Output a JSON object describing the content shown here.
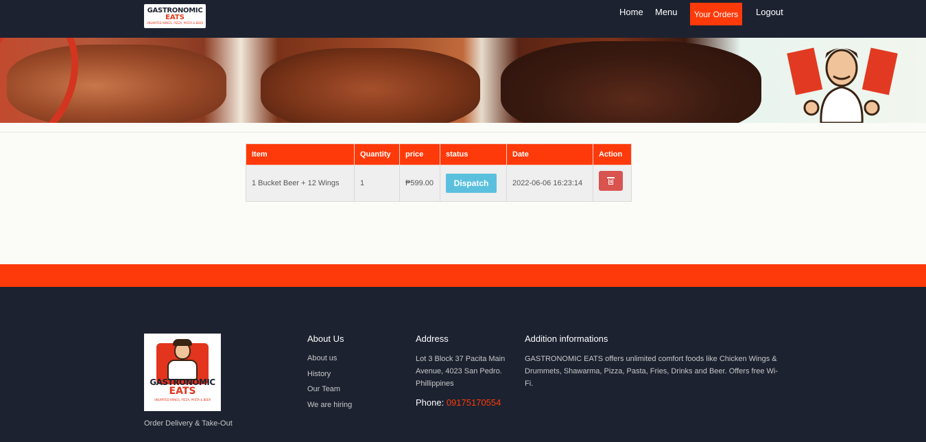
{
  "nav": {
    "logo": {
      "line1": "GASTRONOMIC",
      "line2": "EATS",
      "line3": "UNLIMITED WINGS, PIZZA, PASTA & BEER"
    },
    "items": [
      {
        "label": "Home"
      },
      {
        "label": "Menu"
      },
      {
        "label": "Your Orders"
      },
      {
        "label": "Logout"
      }
    ],
    "active_color": "#ff3a0a",
    "bg_color": "#1c2230"
  },
  "orders": {
    "headers": [
      "Item",
      "Quantity",
      "price",
      "status",
      "Date",
      "Action"
    ],
    "rows": [
      {
        "item": "1 Bucket Beer + 12 Wings",
        "quantity": "1",
        "price": "₱599.00",
        "status": "Dispatch",
        "date": "2022-06-06 16:23:14",
        "action_icon": "trash-icon"
      }
    ]
  },
  "footer": {
    "logo": {
      "line1": "GASTRONOMIC",
      "line2": "EATS",
      "line3": "UNLIMITED WINGS, PIZZA, PASTA & BEER"
    },
    "tagline": "Order Delivery & Take-Out",
    "about": {
      "heading": "About Us",
      "links": [
        "About us",
        "History",
        "Our Team",
        "We are hiring"
      ]
    },
    "address": {
      "heading": "Address",
      "text": "Lot 3 Block 37 Pacita Main Avenue, 4023 San Pedro. Phillippines",
      "phone_label": "Phone: ",
      "phone_number": "09175170554"
    },
    "info": {
      "heading": "Addition informations",
      "text": "GASTRONOMIC EATS offers unlimited comfort foods like Chicken Wings & Drummets, Shawarma, Pizza, Pasta, Fries, Drinks and Beer. Offers free Wi-Fi."
    }
  }
}
